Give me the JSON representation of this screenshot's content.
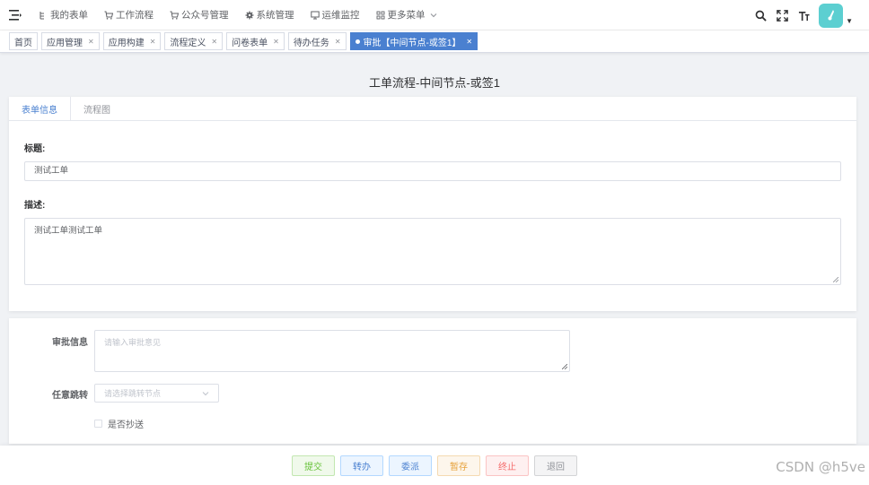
{
  "nav": {
    "menu": [
      {
        "label": "我的表单",
        "icon": "tree-icon"
      },
      {
        "label": "工作流程",
        "icon": "cart-icon"
      },
      {
        "label": "公众号管理",
        "icon": "cart-icon"
      },
      {
        "label": "系统管理",
        "icon": "gear-icon"
      },
      {
        "label": "运维监控",
        "icon": "monitor-icon"
      },
      {
        "label": "更多菜单",
        "icon": "grid-icon"
      }
    ]
  },
  "tags": [
    {
      "label": "首页",
      "closable": false,
      "active": false
    },
    {
      "label": "应用管理",
      "closable": true,
      "active": false
    },
    {
      "label": "应用构建",
      "closable": true,
      "active": false
    },
    {
      "label": "流程定义",
      "closable": true,
      "active": false
    },
    {
      "label": "问卷表单",
      "closable": true,
      "active": false
    },
    {
      "label": "待办任务",
      "closable": true,
      "active": false
    },
    {
      "label": "审批【中间节点-或签1】",
      "closable": true,
      "active": true
    }
  ],
  "page_title": "工单流程-中间节点-或签1",
  "form_tabs": [
    {
      "label": "表单信息",
      "active": true
    },
    {
      "label": "流程图",
      "active": false
    }
  ],
  "form": {
    "title_label": "标题:",
    "title_value": "测试工单",
    "desc_label": "描述:",
    "desc_value": "测试工单测试工单"
  },
  "approval": {
    "comment_label": "审批信息",
    "comment_placeholder": "请输入审批意见",
    "jump_label": "任意跳转",
    "jump_placeholder": "请选择跳转节点",
    "cc_label": "是否抄送"
  },
  "actions": [
    {
      "label": "提交",
      "color": "#67c23a",
      "bg": "#f0f9eb",
      "border": "#c2e7b0"
    },
    {
      "label": "转办",
      "color": "#4a80d0",
      "bg": "#ecf5ff",
      "border": "#b3d8ff"
    },
    {
      "label": "委派",
      "color": "#4a80d0",
      "bg": "#ecf5ff",
      "border": "#b3d8ff"
    },
    {
      "label": "暂存",
      "color": "#e6a23c",
      "bg": "#fdf6ec",
      "border": "#f5dab1"
    },
    {
      "label": "终止",
      "color": "#f56c6c",
      "bg": "#fef0f0",
      "border": "#fbc4c4"
    },
    {
      "label": "退回",
      "color": "#909399",
      "bg": "#f4f4f5",
      "border": "#d3d4d6"
    }
  ],
  "watermark": "CSDN @h5ve"
}
